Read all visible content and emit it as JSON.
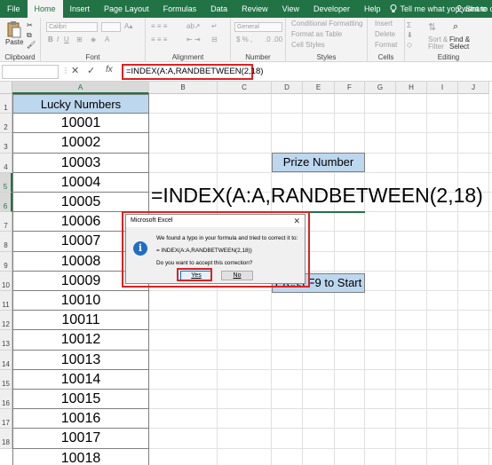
{
  "ribbon_tabs": [
    {
      "label": "File"
    },
    {
      "label": "Home"
    },
    {
      "label": "Insert"
    },
    {
      "label": "Page Layout"
    },
    {
      "label": "Formulas"
    },
    {
      "label": "Data"
    },
    {
      "label": "Review"
    },
    {
      "label": "View"
    },
    {
      "label": "Developer"
    },
    {
      "label": "Help"
    }
  ],
  "tell_me": "Tell me what you want to do",
  "share": "Share",
  "ribbon": {
    "paste": "Paste",
    "font_name": "Calibri",
    "number_format": "General",
    "conditional_formatting": "Conditional Formatting",
    "format_as_table": "Format as Table",
    "cell_styles": "Cell Styles",
    "insert": "Insert",
    "delete": "Delete",
    "format": "Format",
    "sort_filter": "Sort & Filter",
    "find_select": "Find & Select",
    "groups": {
      "clipboard": "Clipboard",
      "font": "Font",
      "alignment": "Alignment",
      "number": "Number",
      "styles": "Styles",
      "cells": "Cells",
      "editing": "Editing"
    }
  },
  "formula_bar": {
    "cancel": "✕",
    "enter": "✓",
    "fx": "fx",
    "value": "=INDEX(A:A,RANDBETWEEN(2,18)"
  },
  "columns": [
    "A",
    "B",
    "C",
    "D",
    "E",
    "F",
    "G",
    "H",
    "I",
    "J"
  ],
  "rows": [
    "1",
    "2",
    "3",
    "4",
    "5",
    "6",
    "7",
    "8",
    "9",
    "10",
    "11",
    "12",
    "13",
    "14",
    "15",
    "16",
    "17",
    "18"
  ],
  "sheet": {
    "header": "Lucky Numbers",
    "numbers": [
      "10001",
      "10002",
      "10003",
      "10004",
      "10005",
      "10006",
      "10007",
      "10008",
      "10009",
      "10010",
      "10011",
      "10012",
      "10013",
      "10014",
      "10015",
      "10016",
      "10017",
      "10018"
    ],
    "prize_label": "Prize Number",
    "formula_display": "=INDEX(A:A,RANDBETWEEN(2,18)",
    "press_label": "Press F9 to Start"
  },
  "dialog": {
    "title": "Microsoft Excel",
    "close": "✕",
    "message": "We found a typo in your formula and tried to correct it to:",
    "corrected": "= INDEX(A:A,RANDBETWEEN(2,18))",
    "question": "Do you want to accept this correction?",
    "yes": "Yes",
    "no": "No"
  }
}
